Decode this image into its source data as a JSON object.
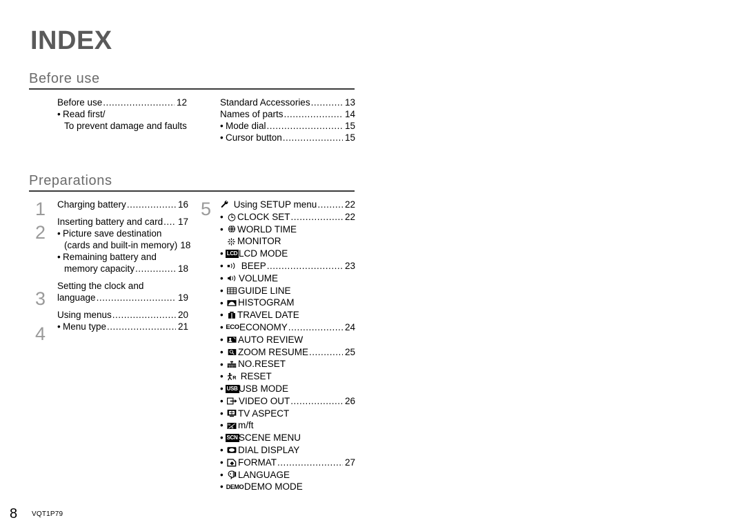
{
  "page": {
    "title": "INDEX",
    "footer_page_number": "8",
    "footer_code": "VQT1P79",
    "colors": {
      "title_gray": "#5a5a5a",
      "heading_gray": "#6b6b6b",
      "rule_dark": "#3a3a3a",
      "step_number_gray": "#9a9a9a",
      "text_black": "#000000",
      "background": "#ffffff"
    }
  },
  "sections": [
    {
      "id": "before-use",
      "heading": "Before use",
      "left_column": [
        {
          "label": "Before use",
          "page": "12",
          "bullet": false,
          "dots": true,
          "indent": false
        },
        {
          "label": "Read first/",
          "page": "",
          "bullet": true,
          "dots": false,
          "indent": false
        },
        {
          "label": "To prevent damage and faults",
          "page": "",
          "bullet": false,
          "dots": false,
          "indent": true
        }
      ],
      "right_column": [
        {
          "label": "Standard Accessories",
          "page": "13",
          "bullet": false,
          "dots": true,
          "indent": false
        },
        {
          "label": "Names of parts",
          "page": "14",
          "bullet": false,
          "dots": true,
          "indent": false
        },
        {
          "label": "Mode dial",
          "page": "15",
          "bullet": true,
          "dots": true,
          "indent": false
        },
        {
          "label": "Cursor button",
          "page": "15",
          "bullet": true,
          "dots": true,
          "indent": false
        }
      ]
    },
    {
      "id": "preparations",
      "heading": "Preparations",
      "step_numbers": [
        "1",
        "2",
        "3",
        "4",
        "5"
      ],
      "left_column": [
        {
          "label": "Charging battery",
          "page": "16",
          "bullet": false,
          "dots": true,
          "indent": false
        },
        {
          "spacer": true
        },
        {
          "label": "Inserting battery and card",
          "page": "17",
          "bullet": false,
          "dots": true,
          "indent": false
        },
        {
          "label": "Picture save destination",
          "page": "",
          "bullet": true,
          "dots": false,
          "indent": false
        },
        {
          "label": "(cards and built-in memory)",
          "page": "18",
          "bullet": false,
          "dots": true,
          "indent": true
        },
        {
          "label": "Remaining battery and",
          "page": "",
          "bullet": true,
          "dots": false,
          "indent": false
        },
        {
          "label": "memory capacity",
          "page": "18",
          "bullet": false,
          "dots": true,
          "indent": true
        },
        {
          "spacer": true
        },
        {
          "label": "Setting the clock and",
          "page": "",
          "bullet": false,
          "dots": false,
          "indent": false
        },
        {
          "label": "language",
          "page": "19",
          "bullet": false,
          "dots": true,
          "indent": false
        },
        {
          "spacer": true
        },
        {
          "label": "Using menus",
          "page": "20",
          "bullet": false,
          "dots": true,
          "indent": false
        },
        {
          "label": "Menu type",
          "page": "21",
          "bullet": true,
          "dots": true,
          "indent": false
        }
      ],
      "setup_menu": [
        {
          "icon": "wrench-icon",
          "label": "Using SETUP menu",
          "page": "22",
          "bullet": false,
          "dots": true
        },
        {
          "icon": "clock-icon",
          "label": "CLOCK SET",
          "page": "22",
          "bullet": true,
          "dots": true
        },
        {
          "icon": "globe-icon",
          "label": "WORLD TIME",
          "page": "",
          "bullet": true,
          "dots": false
        },
        {
          "icon": "brightness-icon",
          "label": "MONITOR",
          "page": "",
          "bullet": true,
          "dots": false
        },
        {
          "icon": "lcd-icon",
          "label": "LCD MODE",
          "page": "",
          "bullet": true,
          "dots": false
        },
        {
          "icon": "beep-icon",
          "label": "BEEP",
          "page": "23",
          "bullet": true,
          "dots": true
        },
        {
          "icon": "speaker-icon",
          "label": "VOLUME",
          "page": "",
          "bullet": true,
          "dots": false
        },
        {
          "icon": "grid-icon",
          "label": "GUIDE LINE",
          "page": "",
          "bullet": true,
          "dots": false
        },
        {
          "icon": "histogram-icon",
          "label": "HISTOGRAM",
          "page": "",
          "bullet": true,
          "dots": false
        },
        {
          "icon": "suitcase-icon",
          "label": "TRAVEL DATE",
          "page": "",
          "bullet": true,
          "dots": false
        },
        {
          "icon": "eco-icon",
          "label": "ECONOMY",
          "page": "24",
          "bullet": true,
          "dots": true
        },
        {
          "icon": "auto-review-icon",
          "label": "AUTO REVIEW",
          "page": "",
          "bullet": true,
          "dots": false
        },
        {
          "icon": "zoom-resume-icon",
          "label": "ZOOM RESUME",
          "page": "25",
          "bullet": true,
          "dots": true
        },
        {
          "icon": "no-reset-icon",
          "label": "NO.RESET",
          "page": "",
          "bullet": true,
          "dots": false
        },
        {
          "icon": "reset-icon",
          "label": "RESET",
          "page": "",
          "bullet": true,
          "dots": false
        },
        {
          "icon": "usb-icon",
          "label": "USB MODE",
          "page": "",
          "bullet": true,
          "dots": false
        },
        {
          "icon": "video-out-icon",
          "label": "VIDEO OUT",
          "page": "26",
          "bullet": true,
          "dots": true
        },
        {
          "icon": "tv-aspect-icon",
          "label": "TV ASPECT",
          "page": "",
          "bullet": true,
          "dots": false
        },
        {
          "icon": "meter-feet-icon",
          "label": "m/ft",
          "page": "",
          "bullet": true,
          "dots": false
        },
        {
          "icon": "scene-menu-icon",
          "label": "SCENE MENU",
          "page": "",
          "bullet": true,
          "dots": false
        },
        {
          "icon": "dial-display-icon",
          "label": "DIAL DISPLAY",
          "page": "",
          "bullet": true,
          "dots": false
        },
        {
          "icon": "format-icon",
          "label": "FORMAT",
          "page": "27",
          "bullet": true,
          "dots": true
        },
        {
          "icon": "language-icon",
          "label": "LANGUAGE",
          "page": "",
          "bullet": true,
          "dots": false
        },
        {
          "icon": "demo-icon",
          "label": "DEMO MODE",
          "page": "",
          "bullet": true,
          "dots": false
        }
      ]
    }
  ]
}
